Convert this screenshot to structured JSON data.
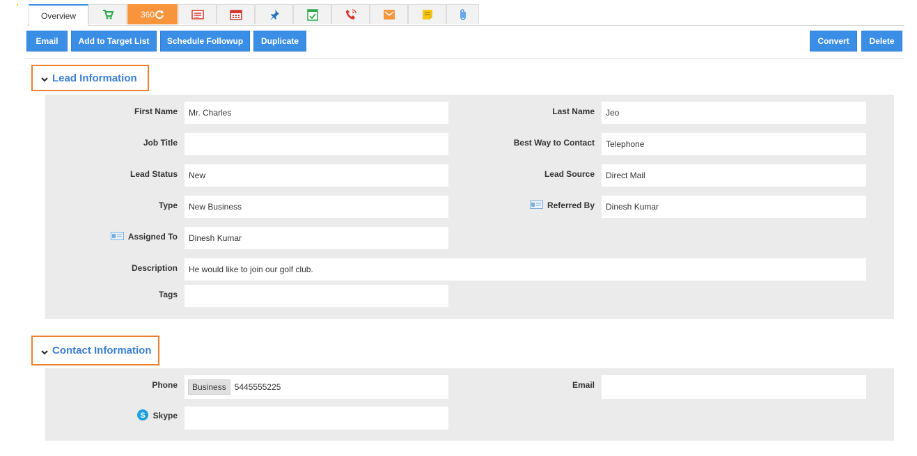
{
  "tabs": {
    "overview_label": "Overview",
    "t360_label": "360",
    "icons": [
      "cart-icon",
      "360-icon",
      "list-icon",
      "calendar-icon",
      "pin-icon",
      "check-calendar-icon",
      "phone-icon",
      "mail-icon",
      "note-icon",
      "attachment-icon"
    ]
  },
  "toolbar": {
    "email": "Email",
    "add_target": "Add to Target List",
    "schedule": "Schedule Followup",
    "duplicate": "Duplicate",
    "convert": "Convert",
    "delete": "Delete"
  },
  "lead": {
    "title": "Lead Information",
    "first_name_label": "First Name",
    "first_name": "Mr. Charles",
    "last_name_label": "Last Name",
    "last_name": "Jeo",
    "job_title_label": "Job Title",
    "job_title": "",
    "best_way_label": "Best Way to Contact",
    "best_way": "Telephone",
    "lead_status_label": "Lead Status",
    "lead_status": "New",
    "lead_source_label": "Lead Source",
    "lead_source": "Direct Mail",
    "type_label": "Type",
    "type": "New Business",
    "referred_by_label": "Referred By",
    "referred_by": "Dinesh Kumar",
    "assigned_to_label": "Assigned To",
    "assigned_to": "Dinesh Kumar",
    "description_label": "Description",
    "description": "He would like to join our golf club.",
    "tags_label": "Tags",
    "tags": ""
  },
  "contact": {
    "title": "Contact Information",
    "phone_label": "Phone",
    "phone_type": "Business",
    "phone": "5445555225",
    "email_label": "Email",
    "email": "",
    "skype_label": "Skype",
    "skype": ""
  },
  "colors": {
    "accent": "#3a8ee6",
    "section_border": "#ef7f2a",
    "tab_360": "#f7943c",
    "panel_bg": "#ebebeb"
  }
}
